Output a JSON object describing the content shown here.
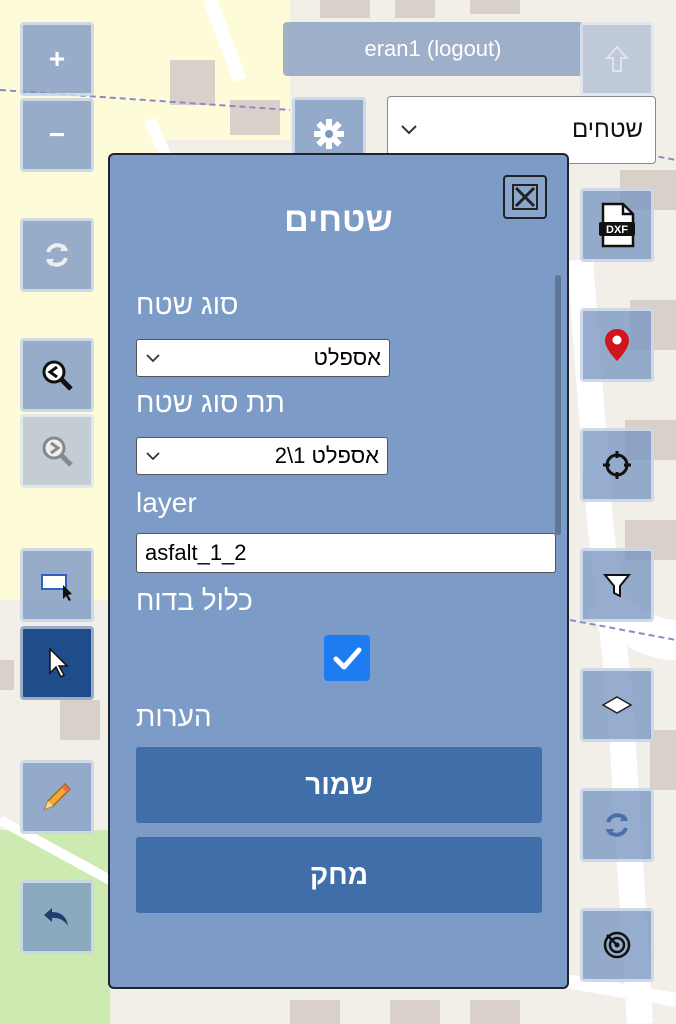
{
  "user": {
    "name_label": "eran1 (logout)"
  },
  "layer_select": {
    "value": "שטחים"
  },
  "zoom": {
    "in_label": "+",
    "out_label": "−"
  },
  "dialog": {
    "title": "שטחים",
    "area_type": {
      "label": "סוג שטח",
      "value": "אספלט"
    },
    "area_subtype": {
      "label": "תת סוג שטח",
      "value": "אספלט 1\\2"
    },
    "layer": {
      "label": "layer",
      "value": "asfalt_1_2"
    },
    "include_in_report": {
      "label": "כלול בדוח",
      "checked": true
    },
    "notes": {
      "label": "הערות"
    },
    "save_label": "שמור",
    "delete_label": "מחק"
  },
  "icons": {
    "left": [
      "plus-icon",
      "minus-icon",
      "refresh-icon",
      "zoom-previous-icon",
      "zoom-next-icon",
      "select-box-icon",
      "pointer-icon",
      "pencil-icon",
      "undo-icon"
    ],
    "right": [
      "arrow-up-icon",
      "dxf-file-icon",
      "map-pin-icon",
      "crosshair-icon",
      "filter-icon",
      "layers-icon",
      "sync-icon",
      "target-icon"
    ]
  },
  "colors": {
    "accent": "#1f4c8a",
    "dialog_bg": "#7c9bc6",
    "button": "#3f6ea8",
    "checkbox": "#1e7cf2",
    "pin": "#d0151c"
  }
}
